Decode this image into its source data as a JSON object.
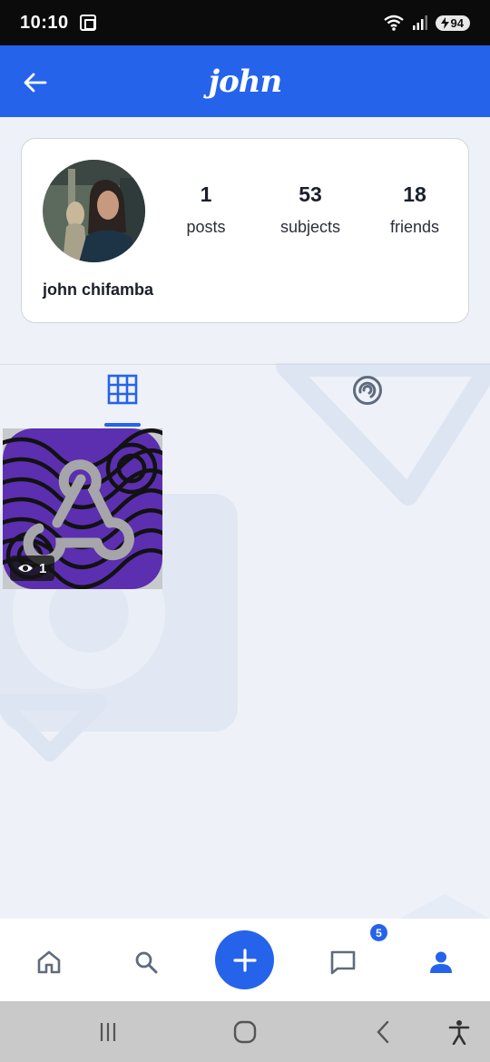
{
  "status_bar": {
    "time": "10:10",
    "battery": "94"
  },
  "header": {
    "title": "john",
    "back_icon": "arrow-left-icon"
  },
  "profile": {
    "name": "john chifamba",
    "stats": [
      {
        "value": "1",
        "label": "posts"
      },
      {
        "value": "53",
        "label": "subjects"
      },
      {
        "value": "18",
        "label": "friends"
      }
    ]
  },
  "tabs": [
    {
      "icon": "grid-icon",
      "active": true
    },
    {
      "icon": "subjects-swirl-icon",
      "active": false
    }
  ],
  "posts": [
    {
      "views": "1",
      "icon": "webhook-icon"
    }
  ],
  "bottom_nav": {
    "items": [
      "home-icon",
      "search-icon",
      "add-icon",
      "chat-icon",
      "profile-icon"
    ],
    "chat_badge": "5"
  },
  "colors": {
    "accent": "#2563eb",
    "background": "#eef2f8"
  }
}
